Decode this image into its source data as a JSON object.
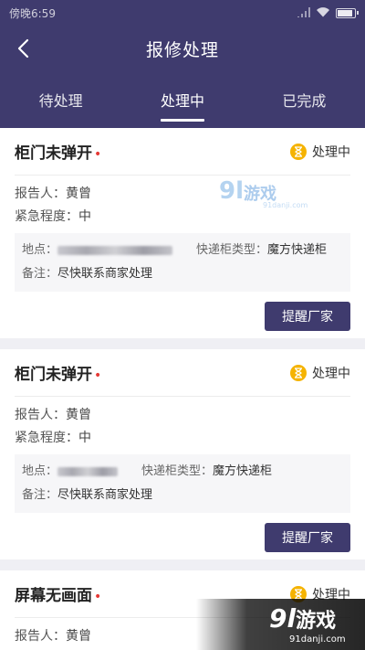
{
  "statusbar": {
    "time": "傍晚6:59"
  },
  "nav": {
    "title": "报修处理"
  },
  "tabs": [
    {
      "label": "待处理"
    },
    {
      "label": "处理中"
    },
    {
      "label": "已完成"
    }
  ],
  "labels": {
    "reporter": "报告人：",
    "urgency": "紧急程度：",
    "address": "地点：",
    "locker_type": "快递柜类型：",
    "note": "备注："
  },
  "cards": [
    {
      "title": "柜门未弹开",
      "status": "处理中",
      "reporter": "黄曾",
      "urgency": "中",
      "locker_type": "魔方快递柜",
      "note": "尽快联系商家处理",
      "button": "提醒厂家"
    },
    {
      "title": "柜门未弹开",
      "status": "处理中",
      "reporter": "黄曾",
      "urgency": "中",
      "locker_type": "魔方快递柜",
      "note": "尽快联系商家处理",
      "button": "提醒厂家"
    },
    {
      "title": "屏幕无画面",
      "status": "处理中",
      "reporter": "黄曾"
    }
  ],
  "watermark": {
    "logo": "9l",
    "brand": "游戏",
    "site": "91danji.com"
  },
  "colors": {
    "primary": "#3f3b6e",
    "status_icon": "#f5b301",
    "dot": "#e53935"
  }
}
